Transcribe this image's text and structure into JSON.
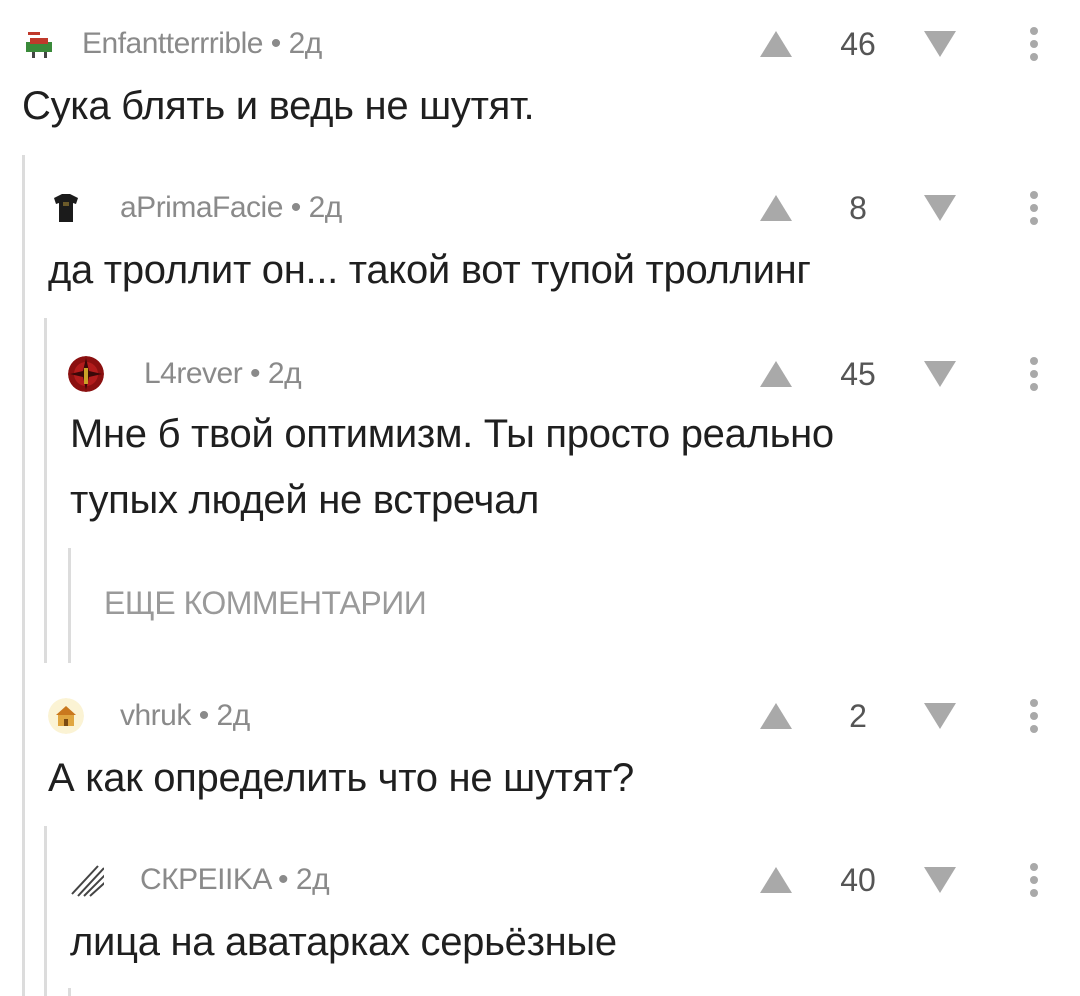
{
  "comments": [
    {
      "author": "Enfantterrrible",
      "time": "2д",
      "score": "46",
      "text": "Сука блять и ведь не шутят."
    },
    {
      "author": "aPrimaFacie",
      "time": "2д",
      "score": "8",
      "text": "да троллит он... такой вот тупой троллинг"
    },
    {
      "author": "L4rever",
      "time": "2д",
      "score": "45",
      "text_line1": "Мне б твой оптимизм. Ты просто реально",
      "text_line2": "тупых людей не встречал"
    },
    {
      "author": "vhruk",
      "time": "2д",
      "score": "2",
      "text": "А как определить что не шутят?"
    },
    {
      "author": "СКРЕIIKA",
      "time": "2д",
      "score": "40",
      "text": "лица на аватарках серьёзные"
    }
  ],
  "more_comments_label": "ЕЩЕ КОММЕНТАРИИ",
  "separator": " • ",
  "icons": {
    "upvote": "triangle-up-icon",
    "downvote": "triangle-down-icon",
    "more": "vertical-dots-icon"
  }
}
